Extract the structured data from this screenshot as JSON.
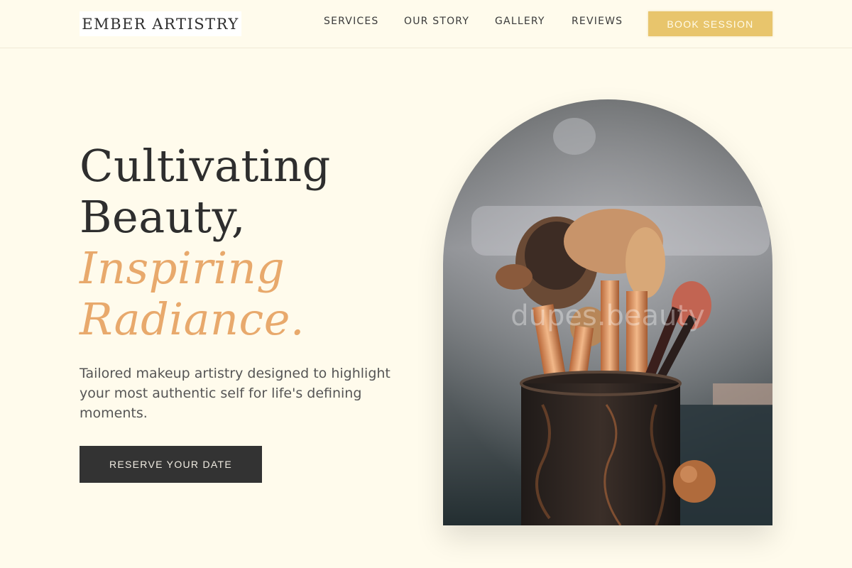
{
  "brand": {
    "name": "EMBER ARTISTRY"
  },
  "nav": {
    "items": [
      {
        "label": "SERVICES"
      },
      {
        "label": "OUR STORY"
      },
      {
        "label": "GALLERY"
      },
      {
        "label": "REVIEWS"
      }
    ],
    "cta_label": "BOOK SESSION"
  },
  "hero": {
    "headline_line1": "Cultivating",
    "headline_line2": "Beauty,",
    "headline_accent1": "Inspiring",
    "headline_accent2": "Radiance.",
    "description": "Tailored makeup artistry designed to highlight your most authentic self for life's defining moments.",
    "cta_label": "RESERVE YOUR DATE",
    "image_watermark": "dupes.beauty"
  },
  "colors": {
    "background": "#fffbec",
    "accent": "#e8a96c",
    "book_button": "#e8c56c",
    "dark_button": "#333333",
    "text": "#2e2e2e"
  }
}
